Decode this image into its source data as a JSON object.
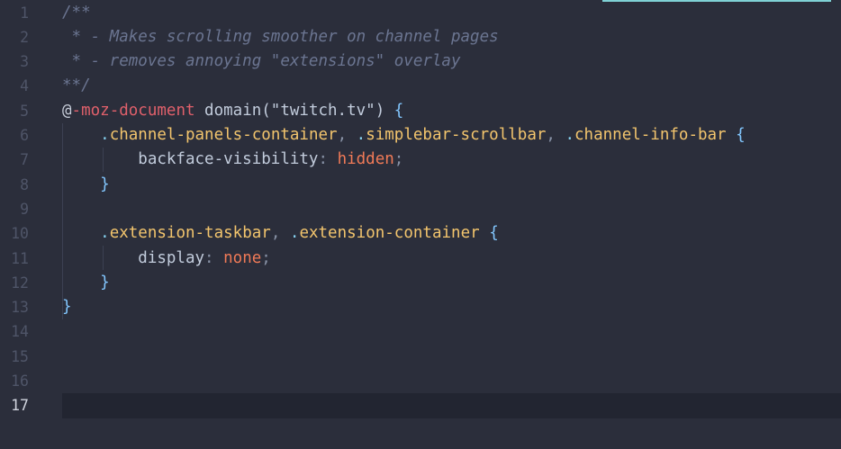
{
  "editor": {
    "current_line": 17,
    "lines": [
      {
        "num": "1",
        "tokens": [
          {
            "t": "/**",
            "c": "comment"
          }
        ]
      },
      {
        "num": "2",
        "tokens": [
          {
            "t": " * - Makes scrolling smoother on channel pages",
            "c": "comment"
          }
        ]
      },
      {
        "num": "3",
        "tokens": [
          {
            "t": " * - removes annoying \"extensions\" overlay",
            "c": "comment"
          }
        ]
      },
      {
        "num": "4",
        "tokens": [
          {
            "t": "**/",
            "c": "comment"
          }
        ]
      },
      {
        "num": "5",
        "tokens": [
          {
            "t": "@",
            "c": "at"
          },
          {
            "t": "-moz-document",
            "c": "keyword"
          },
          {
            "t": " domain(\"twitch.tv\") ",
            "c": "plain"
          },
          {
            "t": "{",
            "c": "brace"
          }
        ]
      },
      {
        "num": "6",
        "tokens": [
          {
            "t": "    ",
            "c": "plain"
          },
          {
            "t": ".",
            "c": "dot"
          },
          {
            "t": "channel-panels-container",
            "c": "selector"
          },
          {
            "t": ", ",
            "c": "punct"
          },
          {
            "t": ".",
            "c": "dot"
          },
          {
            "t": "simplebar-scrollbar",
            "c": "selector"
          },
          {
            "t": ", ",
            "c": "punct"
          },
          {
            "t": ".",
            "c": "dot"
          },
          {
            "t": "channel-info-bar",
            "c": "selector"
          },
          {
            "t": " ",
            "c": "plain"
          },
          {
            "t": "{",
            "c": "brace"
          }
        ]
      },
      {
        "num": "7",
        "tokens": [
          {
            "t": "        backface-visibility",
            "c": "plain"
          },
          {
            "t": ": ",
            "c": "punct"
          },
          {
            "t": "hidden",
            "c": "value"
          },
          {
            "t": ";",
            "c": "punct"
          }
        ]
      },
      {
        "num": "8",
        "tokens": [
          {
            "t": "    ",
            "c": "plain"
          },
          {
            "t": "}",
            "c": "brace"
          }
        ]
      },
      {
        "num": "9",
        "tokens": []
      },
      {
        "num": "10",
        "tokens": [
          {
            "t": "    ",
            "c": "plain"
          },
          {
            "t": ".",
            "c": "dot"
          },
          {
            "t": "extension-taskbar",
            "c": "selector"
          },
          {
            "t": ", ",
            "c": "punct"
          },
          {
            "t": ".",
            "c": "dot"
          },
          {
            "t": "extension-container",
            "c": "selector"
          },
          {
            "t": " ",
            "c": "plain"
          },
          {
            "t": "{",
            "c": "brace"
          }
        ]
      },
      {
        "num": "11",
        "tokens": [
          {
            "t": "        display",
            "c": "plain"
          },
          {
            "t": ": ",
            "c": "punct"
          },
          {
            "t": "none",
            "c": "value"
          },
          {
            "t": ";",
            "c": "punct"
          }
        ]
      },
      {
        "num": "12",
        "tokens": [
          {
            "t": "    ",
            "c": "plain"
          },
          {
            "t": "}",
            "c": "brace"
          }
        ]
      },
      {
        "num": "13",
        "tokens": [
          {
            "t": "}",
            "c": "brace"
          }
        ]
      },
      {
        "num": "14",
        "tokens": []
      },
      {
        "num": "15",
        "tokens": []
      },
      {
        "num": "16",
        "tokens": []
      },
      {
        "num": "17",
        "tokens": []
      }
    ]
  }
}
